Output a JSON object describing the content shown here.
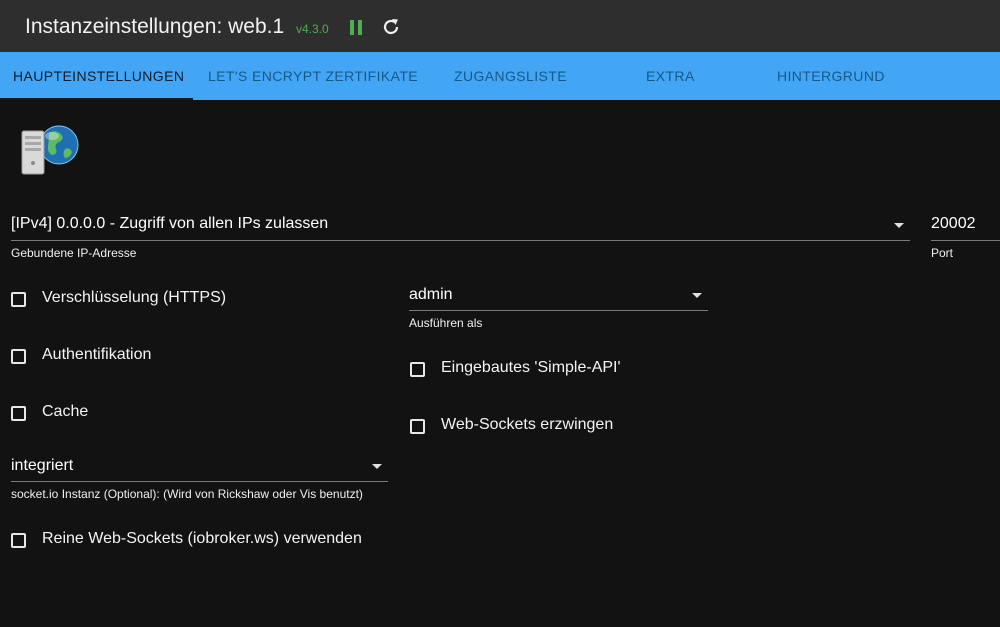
{
  "titlebar": {
    "title": "Instanzeinstellungen: web.1",
    "version": "v4.3.0",
    "pause_icon": "pause-icon",
    "reload_icon": "reload-icon",
    "accent": "#4caf50"
  },
  "tabs": [
    {
      "label": "HAUPTEINSTELLUNGEN",
      "active": true
    },
    {
      "label": "LET'S ENCRYPT ZERTIFIKATE",
      "active": false
    },
    {
      "label": "ZUGANGSLISTE",
      "active": false
    },
    {
      "label": "EXTRA",
      "active": false
    },
    {
      "label": "HINTERGRUND",
      "active": false
    }
  ],
  "tab_bar_color": "#42a5f5",
  "main": {
    "logo_icon": "server-globe-icon",
    "bind": {
      "value": "[IPv4] 0.0.0.0 - Zugriff von allen IPs zulassen",
      "label": "Gebundene IP-Adresse"
    },
    "port": {
      "value": "20002",
      "label": "Port"
    },
    "run_as": {
      "value": "admin",
      "label": "Ausführen als"
    },
    "socketio": {
      "value": "integriert",
      "label": "socket.io Instanz (Optional): (Wird von Rickshaw oder Vis benutzt)"
    },
    "checkboxes": {
      "https": {
        "label": "Verschlüsselung (HTTPS)",
        "checked": false
      },
      "auth": {
        "label": "Authentifikation",
        "checked": false
      },
      "cache": {
        "label": "Cache",
        "checked": false
      },
      "simple_api": {
        "label": "Eingebautes 'Simple-API'",
        "checked": false
      },
      "force_ws": {
        "label": "Web-Sockets erzwingen",
        "checked": false
      },
      "pure_ws": {
        "label": "Reine Web-Sockets (iobroker.ws) verwenden",
        "checked": false
      }
    }
  }
}
